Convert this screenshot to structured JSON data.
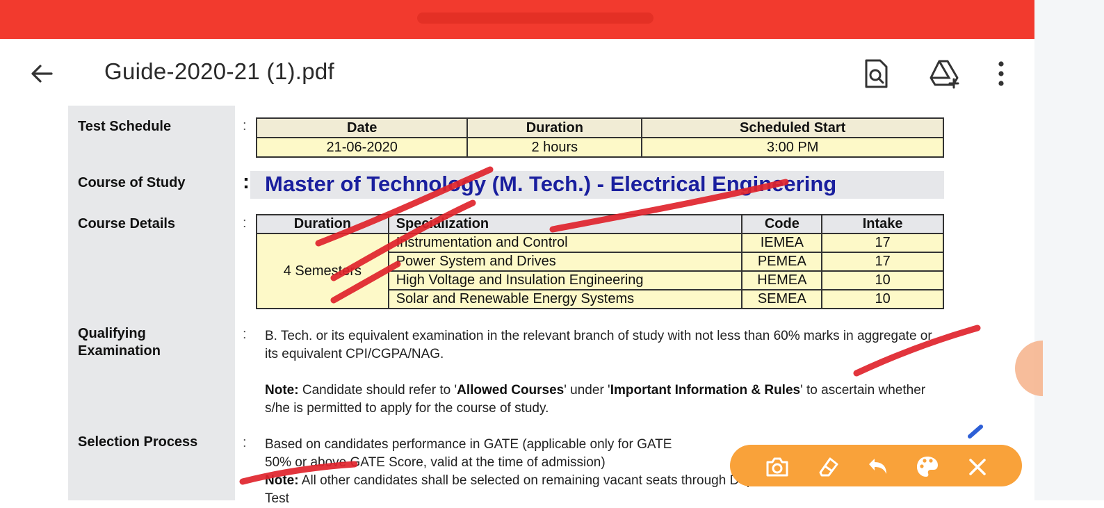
{
  "app_bar": {
    "title": "Guide-2020-21 (1).pdf",
    "icons": [
      "back-arrow-icon",
      "find-in-page-icon",
      "add-to-drive-icon",
      "more-vertical-icon"
    ]
  },
  "test_schedule": {
    "label": "Test Schedule",
    "headers": [
      "Date",
      "Duration",
      "Scheduled Start"
    ],
    "values": [
      "21-06-2020",
      "2 hours",
      "3:00 PM"
    ]
  },
  "course_of_study": {
    "label": "Course of Study",
    "title": "Master of Technology  (M. Tech.) - Electrical Engineering"
  },
  "course_details": {
    "label": "Course Details",
    "headers": [
      "Duration",
      "Specialization",
      "Code",
      "Intake"
    ],
    "duration": "4 Semesters",
    "rows": [
      {
        "specialization": "Instrumentation and Control",
        "code": "IEMEA",
        "intake": "17"
      },
      {
        "specialization": "Power System and Drives",
        "code": "PEMEA",
        "intake": "17"
      },
      {
        "specialization": "High Voltage and Insulation Engineering",
        "code": "HEMEA",
        "intake": "10"
      },
      {
        "specialization": "Solar and Renewable Energy Systems",
        "code": "SEMEA",
        "intake": "10"
      }
    ]
  },
  "qualifying_examination": {
    "label_line1": "Qualifying",
    "label_line2": "Examination",
    "text": "B. Tech. or its equivalent examination in the relevant branch of study with not less than 60% marks in aggregate or its equivalent CPI/CGPA/NAG.",
    "note_label": "Note:",
    "note_part1": " Candidate should refer to '",
    "note_bold1": "Allowed Courses",
    "note_part2": "' under '",
    "note_bold2": "Important Information & Rules",
    "note_part3": "' to ascertain whether s/he is permitted to apply for the course of study."
  },
  "selection_process": {
    "label": "Selection Process",
    "line1": "Based on candidates performance in GATE (applicable only for GATE",
    "line2": "50% or above GATE Score, valid at the time of admission)",
    "note_label": "Note:",
    "note_text": " All other candidates shall be selected on remaining vacant seats through Departmental",
    "line4": "Test"
  },
  "annotation_toolbar": {
    "buttons": [
      "camera-icon",
      "eraser-icon",
      "undo-icon",
      "palette-icon",
      "close-icon"
    ],
    "color": "#f9a23a"
  },
  "colors": {
    "status_bar": "#f23a2e",
    "ink": "#e0242c",
    "course_title": "#1a1f9e",
    "table_fill": "#fdf9c8"
  }
}
